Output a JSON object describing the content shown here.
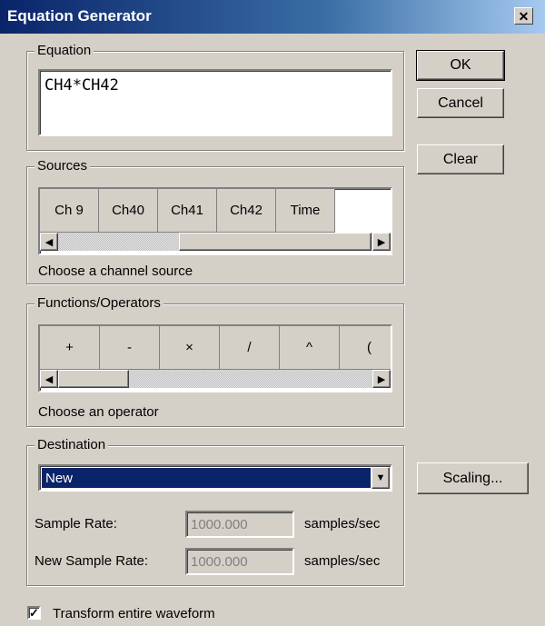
{
  "window": {
    "title": "Equation Generator",
    "close_glyph": "✕"
  },
  "buttons": {
    "ok": "OK",
    "cancel": "Cancel",
    "clear": "Clear",
    "scaling": "Scaling..."
  },
  "equation": {
    "label": "Equation",
    "value": "CH4*CH42"
  },
  "sources": {
    "label": "Sources",
    "items": [
      "Ch 9",
      "Ch40",
      "Ch41",
      "Ch42",
      "Time"
    ],
    "hint": "Choose a channel source"
  },
  "functions": {
    "label": "Functions/Operators",
    "items": [
      "+",
      "-",
      "×",
      "/",
      "^",
      "("
    ],
    "hint": "Choose an operator"
  },
  "destination": {
    "label": "Destination",
    "selected": "New",
    "sample_rate_label": "Sample Rate:",
    "sample_rate_value": "1000.000",
    "new_sample_rate_label": "New Sample Rate:",
    "new_sample_rate_value": "1000.000",
    "unit": "samples/sec"
  },
  "transform": {
    "label": "Transform entire waveform",
    "checked": true,
    "check_glyph": "✓"
  },
  "icons": {
    "left_arrow": "◀",
    "right_arrow": "▶",
    "down_arrow": "▼"
  }
}
